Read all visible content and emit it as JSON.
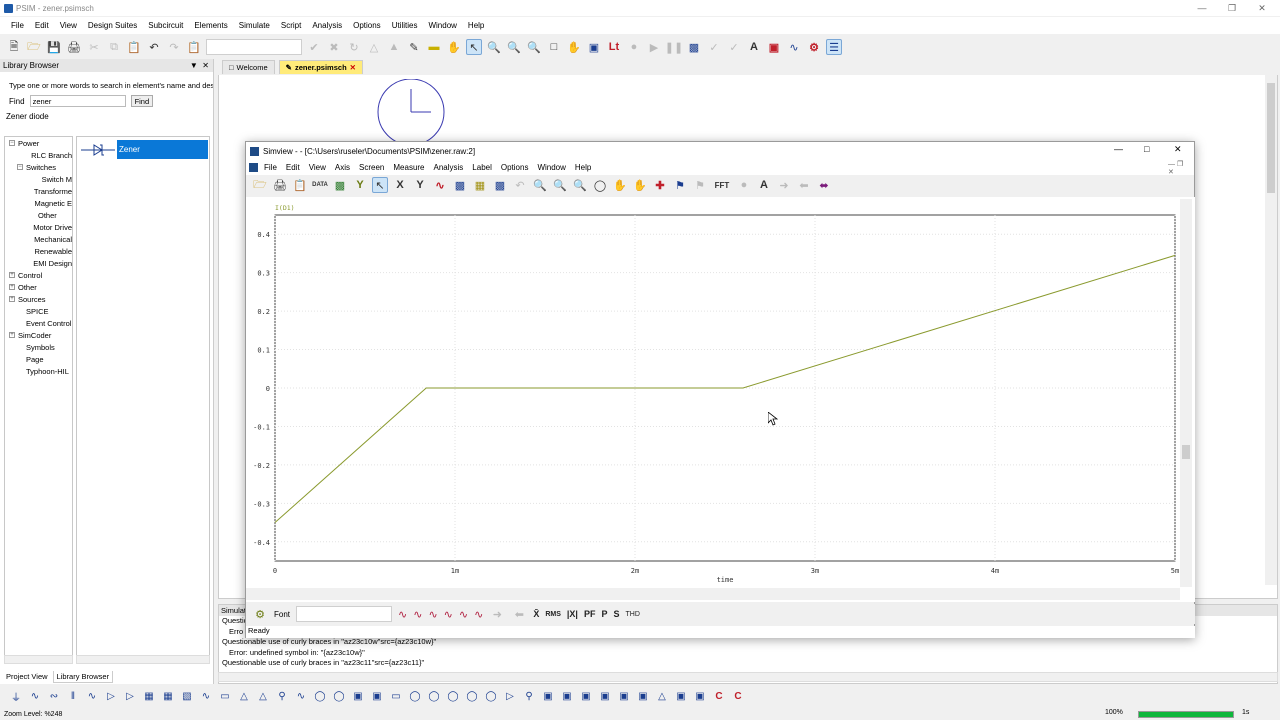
{
  "app": {
    "title": "PSIM - zener.psimsch",
    "menu": [
      "File",
      "Edit",
      "View",
      "Design Suites",
      "Subcircuit",
      "Elements",
      "Simulate",
      "Script",
      "Analysis",
      "Options",
      "Utilities",
      "Window",
      "Help"
    ]
  },
  "library": {
    "header": "Library Browser",
    "hint": "Type one or more words to search in element's name and desc",
    "find_label": "Find",
    "find_value": "zener",
    "find_button": "Find",
    "description": "Zener diode",
    "tree": [
      {
        "label": "Power",
        "level": 0,
        "expanded": true
      },
      {
        "label": "RLC Branch",
        "level": 2
      },
      {
        "label": "Switches",
        "level": 1,
        "expanded": true
      },
      {
        "label": "Switch M",
        "level": 3
      },
      {
        "label": "Transforme",
        "level": 2
      },
      {
        "label": "Magnetic E",
        "level": 2
      },
      {
        "label": "Other",
        "level": 2
      },
      {
        "label": "Motor Drive",
        "level": 2
      },
      {
        "label": "Mechanical",
        "level": 2
      },
      {
        "label": "Renewable",
        "level": 2
      },
      {
        "label": "EMI Design",
        "level": 2
      },
      {
        "label": "Control",
        "level": 0,
        "expanded": false
      },
      {
        "label": "Other",
        "level": 0,
        "expanded": false
      },
      {
        "label": "Sources",
        "level": 0,
        "expanded": false
      },
      {
        "label": "SPICE",
        "level": 1
      },
      {
        "label": "Event Control",
        "level": 1
      },
      {
        "label": "SimCoder",
        "level": 0,
        "expanded": false
      },
      {
        "label": "Symbols",
        "level": 1
      },
      {
        "label": "Page",
        "level": 1
      },
      {
        "label": "Typhoon-HIL",
        "level": 1
      }
    ],
    "result": "Zener",
    "tabs": [
      "Project View",
      "Library Browser"
    ]
  },
  "doc_tabs": [
    "Welcome",
    "zener.psimsch"
  ],
  "messages": {
    "title": "Simulat",
    "lines": [
      "Questiona",
      "Erro",
      "Questionable use of curly braces in \"az23c10w\"src={az23c10w}\"",
      "Error: undefined symbol in: \"{az23c10w}\"",
      "Questionable use of curly braces in \"az23c11\"src={az23c11}\""
    ]
  },
  "status": {
    "zoom": "Zoom Level: %248",
    "zoom_pct": "100%",
    "progress": 1.0,
    "sim_time": "1s"
  },
  "simview": {
    "title": "Simview -  - [C:\\Users\\ruseler\\Documents\\PSIM\\zener.raw:2]",
    "menu": [
      "File",
      "Edit",
      "View",
      "Axis",
      "Screen",
      "Measure",
      "Analysis",
      "Label",
      "Options",
      "Window",
      "Help"
    ],
    "font_label": "Font",
    "bottom_buttons": [
      "RMS",
      "PF",
      "P",
      "S",
      "THD"
    ],
    "status": "Ready"
  },
  "chart_data": {
    "type": "line",
    "series": [
      {
        "name": "I(D1)",
        "x": [
          0,
          0.00084,
          0.0026,
          0.005
        ],
        "y": [
          -0.35,
          0,
          0,
          0.345
        ]
      }
    ],
    "xlabel": "time",
    "ylabel": "",
    "xlim": [
      0,
      0.005
    ],
    "ylim": [
      -0.45,
      0.45
    ],
    "x_ticks": [
      0,
      0.001,
      0.002,
      0.003,
      0.004,
      0.005
    ],
    "x_tick_labels": [
      "0",
      "1m",
      "2m",
      "3m",
      "4m",
      "5m"
    ],
    "y_ticks": [
      -0.4,
      -0.3,
      -0.2,
      -0.1,
      0,
      0.1,
      0.2,
      0.3,
      0.4
    ],
    "y_tick_labels": [
      "-0.4",
      "-0.3",
      "-0.2",
      "-0.1",
      "0",
      "0.1",
      "0.2",
      "0.3",
      "0.4"
    ],
    "grid": true,
    "line_color": "#8a9a2e"
  }
}
